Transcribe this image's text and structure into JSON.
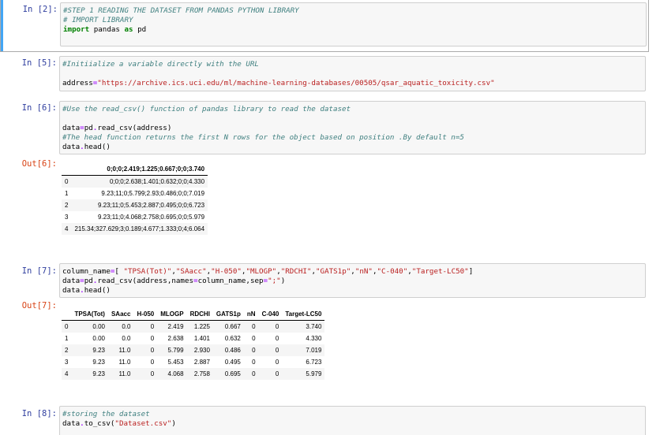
{
  "cells": [
    {
      "prompt": "In [2]:",
      "lines": [
        [
          {
            "t": "#STEP 1 READING THE DATASET FROM PANDAS PYTHON LIBRARY",
            "c": "comment"
          }
        ],
        [
          {
            "t": "# IMPORT LIBRARY",
            "c": "comment"
          }
        ],
        [
          {
            "t": "import",
            "c": "kw"
          },
          {
            "t": " pandas ",
            "c": ""
          },
          {
            "t": "as",
            "c": "kw"
          },
          {
            "t": " pd",
            "c": ""
          }
        ]
      ]
    },
    {
      "prompt": "In [5]:",
      "lines": [
        [
          {
            "t": "#Initiialize a variable directly with the URL",
            "c": "comment"
          }
        ],
        [
          {
            "t": "",
            "c": ""
          }
        ],
        [
          {
            "t": "address",
            "c": ""
          },
          {
            "t": "=",
            "c": "op"
          },
          {
            "t": "\"https://archive.ics.uci.edu/ml/machine-learning-databases/00505/qsar_aquatic_toxicity.csv\"",
            "c": "str"
          }
        ]
      ]
    },
    {
      "prompt": "In [6]:",
      "lines": [
        [
          {
            "t": "#Use the read_csv() function of pandas library to read the dataset",
            "c": "comment"
          }
        ],
        [
          {
            "t": "",
            "c": ""
          }
        ],
        [
          {
            "t": "data",
            "c": ""
          },
          {
            "t": "=",
            "c": "op"
          },
          {
            "t": "pd",
            "c": ""
          },
          {
            "t": ".",
            "c": "op"
          },
          {
            "t": "read_csv(address)",
            "c": ""
          }
        ],
        [
          {
            "t": "#The head function returns the first N rows for the object based on position .By default n=5",
            "c": "comment"
          }
        ],
        [
          {
            "t": "data",
            "c": ""
          },
          {
            "t": ".",
            "c": "op"
          },
          {
            "t": "head()",
            "c": ""
          }
        ]
      ],
      "out_prompt": "Out[6]:",
      "table": {
        "columns": [
          "0;0;0;2.419;1.225;0.667;0;0;3.740"
        ],
        "rows": [
          [
            "0",
            "0;0;0;2.638;1.401;0.632;0;0;4.330"
          ],
          [
            "1",
            "9.23;11;0;5.799;2.93;0.486;0;0;7.019"
          ],
          [
            "2",
            "9.23;11;0;5.453;2.887;0.495;0;0;6.723"
          ],
          [
            "3",
            "9.23;11;0;4.068;2.758;0.695;0;0;5.979"
          ],
          [
            "4",
            "215.34;327.629;3;0.189;4.677;1.333;0;4;6.064"
          ]
        ]
      }
    },
    {
      "prompt": "In [7]:",
      "lines": [
        [
          {
            "t": "column_name",
            "c": ""
          },
          {
            "t": "=",
            "c": "op"
          },
          {
            "t": "[ ",
            "c": ""
          },
          {
            "t": "\"TPSA(Tot)\"",
            "c": "str"
          },
          {
            "t": ",",
            "c": ""
          },
          {
            "t": "\"SAacc\"",
            "c": "str"
          },
          {
            "t": ",",
            "c": ""
          },
          {
            "t": "\"H-050\"",
            "c": "str"
          },
          {
            "t": ",",
            "c": ""
          },
          {
            "t": "\"MLOGP\"",
            "c": "str"
          },
          {
            "t": ",",
            "c": ""
          },
          {
            "t": "\"RDCHI\"",
            "c": "str"
          },
          {
            "t": ",",
            "c": ""
          },
          {
            "t": "\"GATS1p\"",
            "c": "str"
          },
          {
            "t": ",",
            "c": ""
          },
          {
            "t": "\"nN\"",
            "c": "str"
          },
          {
            "t": ",",
            "c": ""
          },
          {
            "t": "\"C-040\"",
            "c": "str"
          },
          {
            "t": ",",
            "c": ""
          },
          {
            "t": "\"Target-LC50\"",
            "c": "str"
          },
          {
            "t": "]",
            "c": ""
          }
        ],
        [
          {
            "t": "data",
            "c": ""
          },
          {
            "t": "=",
            "c": "op"
          },
          {
            "t": "pd",
            "c": ""
          },
          {
            "t": ".",
            "c": "op"
          },
          {
            "t": "read_csv(address,names",
            "c": ""
          },
          {
            "t": "=",
            "c": "op"
          },
          {
            "t": "column_name,sep",
            "c": ""
          },
          {
            "t": "=",
            "c": "op"
          },
          {
            "t": "\";\"",
            "c": "str"
          },
          {
            "t": ")",
            "c": ""
          }
        ],
        [
          {
            "t": "data",
            "c": ""
          },
          {
            "t": ".",
            "c": "op"
          },
          {
            "t": "head()",
            "c": ""
          }
        ]
      ],
      "out_prompt": "Out[7]:",
      "table": {
        "columns": [
          "TPSA(Tot)",
          "SAacc",
          "H-050",
          "MLOGP",
          "RDCHI",
          "GATS1p",
          "nN",
          "C-040",
          "Target-LC50"
        ],
        "rows": [
          [
            "0",
            "0.00",
            "0.0",
            "0",
            "2.419",
            "1.225",
            "0.667",
            "0",
            "0",
            "3.740"
          ],
          [
            "1",
            "0.00",
            "0.0",
            "0",
            "2.638",
            "1.401",
            "0.632",
            "0",
            "0",
            "4.330"
          ],
          [
            "2",
            "9.23",
            "11.0",
            "0",
            "5.799",
            "2.930",
            "0.486",
            "0",
            "0",
            "7.019"
          ],
          [
            "3",
            "9.23",
            "11.0",
            "0",
            "5.453",
            "2.887",
            "0.495",
            "0",
            "0",
            "6.723"
          ],
          [
            "4",
            "9.23",
            "11.0",
            "0",
            "4.068",
            "2.758",
            "0.695",
            "0",
            "0",
            "5.979"
          ]
        ]
      }
    },
    {
      "prompt": "In [8]:",
      "lines": [
        [
          {
            "t": "#storing the dataset",
            "c": "comment"
          }
        ],
        [
          {
            "t": "data",
            "c": ""
          },
          {
            "t": ".",
            "c": "op"
          },
          {
            "t": "to_csv(",
            "c": ""
          },
          {
            "t": "\"Dataset.csv\"",
            "c": "str"
          },
          {
            "t": ")",
            "c": ""
          }
        ]
      ]
    }
  ]
}
